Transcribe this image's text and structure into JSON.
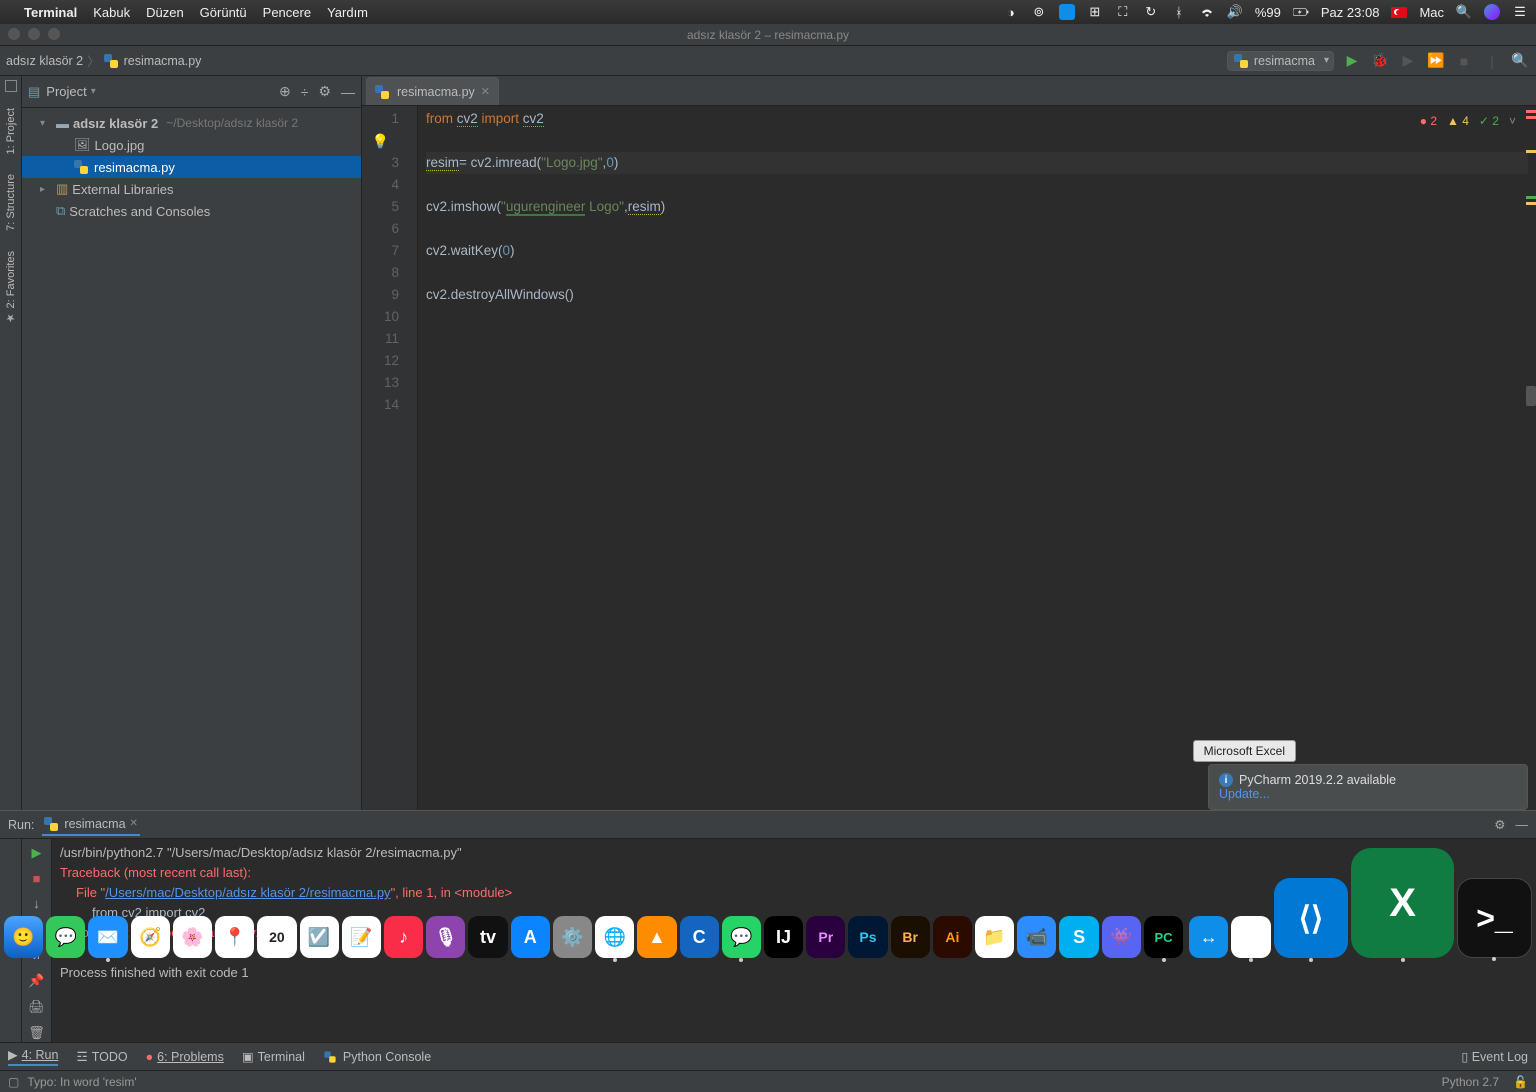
{
  "menubar": {
    "app": "Terminal",
    "items": [
      "Kabuk",
      "Düzen",
      "Görüntü",
      "Pencere",
      "Yardım"
    ],
    "battery": "%99",
    "time": "Paz 23:08",
    "user": "Mac"
  },
  "window": {
    "title": "adsız klasör 2 – resimacma.py"
  },
  "breadcrumb": {
    "root": "adsız klasör 2",
    "file": "resimacma.py"
  },
  "run_config": {
    "label": "resimacma"
  },
  "project_header": {
    "label": "Project"
  },
  "tree": {
    "root": {
      "name": "adsız klasör 2",
      "path": "~/Desktop/adsız klasör 2"
    },
    "files": [
      {
        "name": "Logo.jpg",
        "kind": "img"
      },
      {
        "name": "resimacma.py",
        "kind": "py",
        "selected": true
      }
    ],
    "ext_lib": "External Libraries",
    "scratches": "Scratches and Consoles"
  },
  "editor": {
    "tab": "resimacma.py",
    "analysis": {
      "errors": "2",
      "warnings": "4",
      "ok": "2"
    },
    "lines": [
      {
        "n": "1",
        "segs": [
          {
            "t": "from ",
            "c": "kw"
          },
          {
            "t": "cv2",
            "c": "err-underline id"
          },
          {
            "t": " import ",
            "c": "kw"
          },
          {
            "t": "cv2",
            "c": "id err-underline"
          }
        ]
      },
      {
        "n": "2",
        "segs": [],
        "bulb": true
      },
      {
        "n": "3",
        "hl": true,
        "segs": [
          {
            "t": "resim",
            "c": "id warn-underline"
          },
          {
            "t": "= cv2.imread(",
            "c": "id"
          },
          {
            "t": "\"Logo.jpg\"",
            "c": "str"
          },
          {
            "t": ",",
            "c": "id"
          },
          {
            "t": "0",
            "c": "num"
          },
          {
            "t": ")",
            "c": "id"
          }
        ]
      },
      {
        "n": "4",
        "segs": []
      },
      {
        "n": "5",
        "segs": [
          {
            "t": "cv2.imshow(",
            "c": "id"
          },
          {
            "t": "\"",
            "c": "str"
          },
          {
            "t": "ugurengineer",
            "c": "str green-underline"
          },
          {
            "t": " Logo\"",
            "c": "str"
          },
          {
            "t": ",",
            "c": "id"
          },
          {
            "t": "resim",
            "c": "id warn-underline"
          },
          {
            "t": ")",
            "c": "id"
          }
        ]
      },
      {
        "n": "6",
        "segs": []
      },
      {
        "n": "7",
        "segs": [
          {
            "t": "cv2.waitKey(",
            "c": "id"
          },
          {
            "t": "0",
            "c": "num"
          },
          {
            "t": ")",
            "c": "id"
          }
        ]
      },
      {
        "n": "8",
        "segs": []
      },
      {
        "n": "9",
        "segs": [
          {
            "t": "cv2.destroyAllWindows()",
            "c": "id"
          }
        ]
      },
      {
        "n": "10",
        "segs": []
      },
      {
        "n": "11",
        "segs": []
      },
      {
        "n": "12",
        "segs": []
      },
      {
        "n": "13",
        "segs": []
      },
      {
        "n": "14",
        "segs": []
      }
    ]
  },
  "run": {
    "label": "Run:",
    "tab": "resimacma",
    "lines": {
      "cmd": "/usr/bin/python2.7 \"/Users/mac/Desktop/adsız klasör 2/resimacma.py\"",
      "trace1": "Traceback (most recent call last):",
      "file_pre": "  File \"",
      "file_link": "/Users/mac/Desktop/adsız klasör 2/resimacma.py",
      "file_post": "\", line 1, in <module>",
      "from": "from cv2 import cv2",
      "err": "ImportError: No module named cv2",
      "exit": "Process finished with exit code 1"
    }
  },
  "bottom": {
    "run": "4: Run",
    "todo": "TODO",
    "problems": "6: Problems",
    "terminal": "Terminal",
    "console": "Python Console",
    "event_log": "Event Log"
  },
  "status": {
    "typo": "Typo: In word 'resim'",
    "interpreter": "Python 2.7"
  },
  "notification": {
    "title": "PyCharm 2019.2.2 available",
    "link": "Update..."
  },
  "tooltip": "Microsoft Excel",
  "side_tools": {
    "project": "1: Project",
    "structure": "7: Structure",
    "favorites": "2: Favorites"
  }
}
